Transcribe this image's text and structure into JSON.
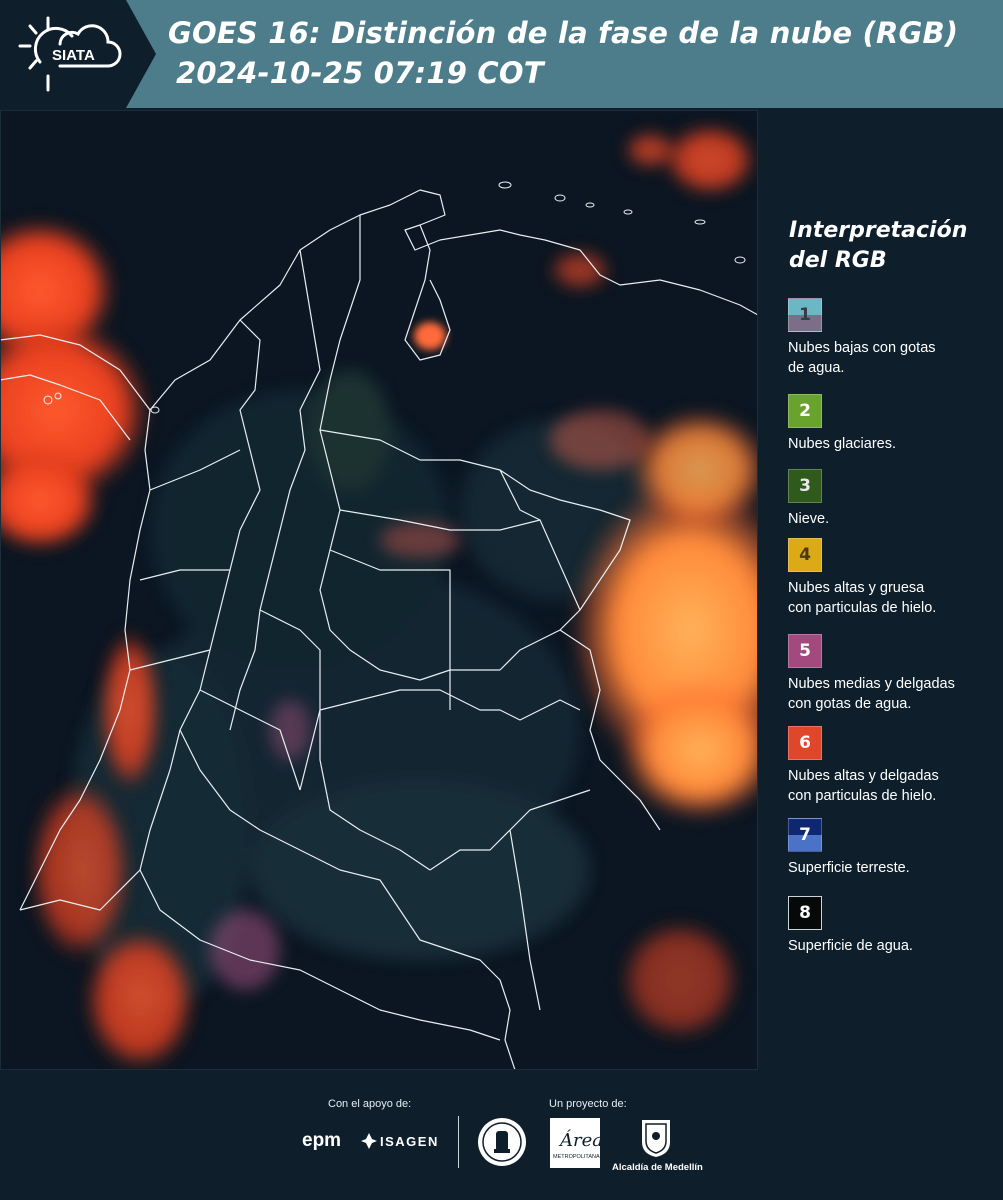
{
  "header": {
    "logo_text": "SIATA",
    "title_line1": "GOES 16: Distinción de la fase de la nube (RGB)",
    "title_line2": "2024-10-25 07:19 COT"
  },
  "legend": {
    "title_line1": "Interpretación",
    "title_line2": "del RGB",
    "items": [
      {
        "num": "1",
        "desc_l1": "Nubes bajas con gotas",
        "desc_l2": "de agua.",
        "color_top": "#6bb7c4",
        "color_bottom": "#7c6e86",
        "num_color": "#3a3a46"
      },
      {
        "num": "2",
        "desc_l1": "Nubes glaciares.",
        "desc_l2": "",
        "color_top": "#6aa22e",
        "color_bottom": "#6aa22e",
        "num_color": "#ffffff"
      },
      {
        "num": "3",
        "desc_l1": "Nieve.",
        "desc_l2": "",
        "color_top": "#2f5a1b",
        "color_bottom": "#2f5a1b",
        "num_color": "#e8e8e8"
      },
      {
        "num": "4",
        "desc_l1": "Nubes altas y gruesa",
        "desc_l2": "con particulas de hielo.",
        "color_top": "#dcaa17",
        "color_bottom": "#dcaa17",
        "num_color": "#4a3a10"
      },
      {
        "num": "5",
        "desc_l1": "Nubes medias y delgadas",
        "desc_l2": "con gotas de agua.",
        "color_top": "#a24a7e",
        "color_bottom": "#a24a7e",
        "num_color": "#ffffff"
      },
      {
        "num": "6",
        "desc_l1": "Nubes altas y delgadas",
        "desc_l2": "con particulas de hielo.",
        "color_top": "#e0472a",
        "color_bottom": "#e0472a",
        "num_color": "#ffffff"
      },
      {
        "num": "7",
        "desc_l1": "Superficie terreste.",
        "desc_l2": "",
        "color_top": "#0e2770",
        "color_bottom": "#4a72c6",
        "num_color": "#ffffff"
      },
      {
        "num": "8",
        "desc_l1": "Superficie de agua.",
        "desc_l2": "",
        "color_top": "#050a08",
        "color_bottom": "#050a08",
        "num_color": "#ffffff"
      }
    ]
  },
  "footer": {
    "support_label": "Con el apoyo de:",
    "project_label": "Un proyecto de:",
    "epm": "epm",
    "isagen": "ISAGEN",
    "area_small": "METROPOLITANA",
    "alcaldia": "Alcaldía de Medellín"
  },
  "colors": {
    "header_bg": "#4d7c8b",
    "logo_bg": "#0e1f2b",
    "page_bg": "#0e1f2b",
    "cloud_hot": "#ff6a2a",
    "cloud_mid": "#ffa24a",
    "ocean": "#0b1622"
  }
}
